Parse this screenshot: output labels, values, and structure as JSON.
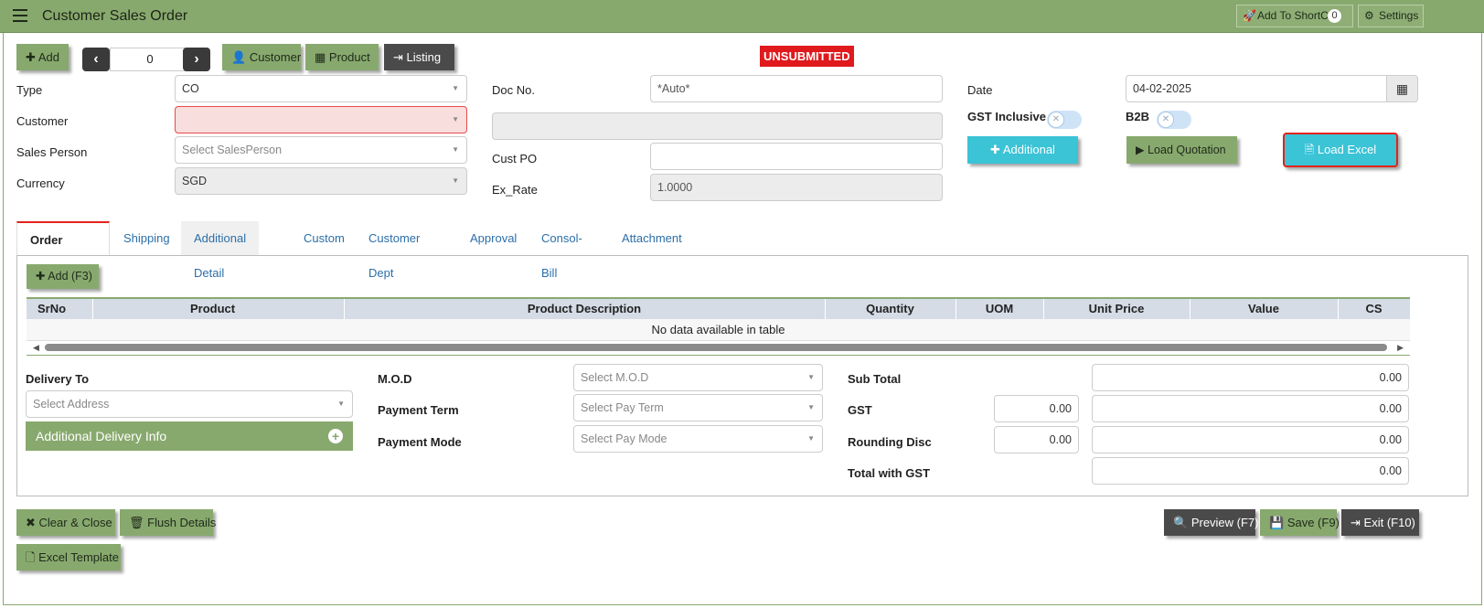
{
  "header": {
    "title": "Customer Sales Order",
    "shortcut_label": "Add To ShortCut",
    "shortcut_count": "0",
    "settings_label": "Settings"
  },
  "toolbar": {
    "add_label": "Add",
    "record_number": "0",
    "customer_label": "Customer",
    "product_label": "Product",
    "listing_label": "Listing"
  },
  "status": "UNSUBMITTED",
  "form": {
    "type_label": "Type",
    "type_value": "CO",
    "customer_label": "Customer",
    "customer_value": "",
    "salesperson_label": "Sales Person",
    "salesperson_placeholder": "Select SalesPerson",
    "currency_label": "Currency",
    "currency_value": "SGD",
    "docno_label": "Doc No.",
    "docno_value": "*Auto*",
    "custpo_label": "Cust PO",
    "custpo_value": "",
    "exrate_label": "Ex_Rate",
    "exrate_value": "1.0000",
    "date_label": "Date",
    "date_value": "04-02-2025",
    "gst_inclusive_label": "GST Inclusive",
    "b2b_label": "B2B",
    "additional_label": "Additional",
    "load_quotation_label": "Load Quotation",
    "load_excel_label": "Load Excel"
  },
  "tabs": [
    "Order Detail",
    "Shipping",
    "Additional Detail",
    "Custom",
    "Customer Dept",
    "Approval",
    "Consol-Bill",
    "Attachment"
  ],
  "grid": {
    "add_label": "Add (F3)",
    "columns": [
      "SrNo",
      "Product",
      "Product Description",
      "Quantity",
      "UOM",
      "Unit Price",
      "Value",
      "CS"
    ],
    "empty_message": "No data available in table"
  },
  "delivery": {
    "label": "Delivery To",
    "address_placeholder": "Select Address",
    "additional_info_label": "Additional Delivery Info"
  },
  "payment": {
    "mod_label": "M.O.D",
    "mod_placeholder": "Select M.O.D",
    "term_label": "Payment Term",
    "term_placeholder": "Select Pay Term",
    "mode_label": "Payment Mode",
    "mode_placeholder": "Select Pay Mode"
  },
  "totals": {
    "subtotal_label": "Sub Total",
    "subtotal_value": "0.00",
    "gst_label": "GST",
    "gst_rate": "0.00",
    "gst_value": "0.00",
    "rounding_label": "Rounding Disc",
    "rounding_rate": "0.00",
    "rounding_value": "0.00",
    "total_label": "Total with GST",
    "total_value": "0.00"
  },
  "footer": {
    "clear_close_label": "Clear & Close",
    "flush_label": "Flush Details",
    "excel_template_label": "Excel Template",
    "preview_label": "Preview (F7)",
    "save_label": "Save (F9)",
    "exit_label": "Exit (F10)"
  },
  "colors": {
    "brand_green": "#88a96e",
    "cyan": "#3bc3d6",
    "status_red": "#e0191d",
    "dark": "#4a4a4a"
  }
}
